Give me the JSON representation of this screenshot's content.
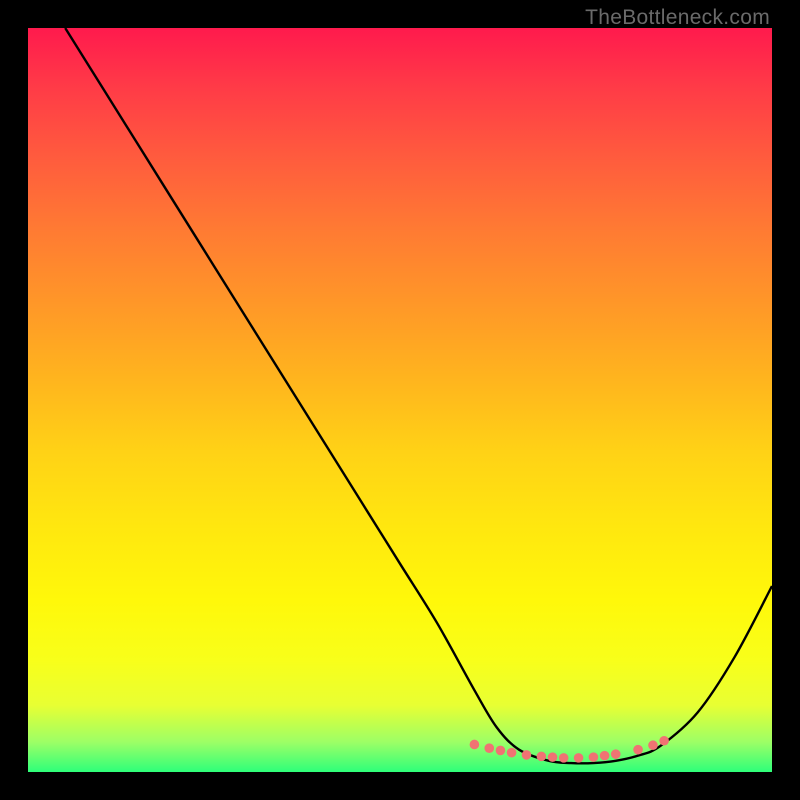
{
  "watermark": "TheBottleneck.com",
  "chart_data": {
    "type": "line",
    "title": "",
    "xlabel": "",
    "ylabel": "",
    "xlim": [
      0,
      100
    ],
    "ylim": [
      0,
      100
    ],
    "background_gradient": {
      "top_color": "#ff1a4d",
      "bottom_color": "#2eff7a",
      "meaning": "bottleneck intensity (red = high, green = low)"
    },
    "series": [
      {
        "name": "bottleneck-curve",
        "x": [
          5,
          10,
          15,
          20,
          25,
          30,
          35,
          40,
          45,
          50,
          55,
          60,
          63,
          66,
          70,
          73,
          76,
          79,
          82,
          85,
          90,
          95,
          100
        ],
        "y": [
          100,
          92,
          84,
          76,
          68,
          60,
          52,
          44,
          36,
          28,
          20,
          11,
          6,
          3,
          1.5,
          1.2,
          1.2,
          1.5,
          2.2,
          3.5,
          8,
          15.5,
          25
        ]
      }
    ],
    "highlight_points": {
      "comment": "soft-red dots near the trough",
      "x": [
        60,
        62,
        63.5,
        65,
        67,
        69,
        70.5,
        72,
        74,
        76,
        77.5,
        79,
        82,
        84,
        85.5
      ],
      "y": [
        3.7,
        3.2,
        2.9,
        2.6,
        2.3,
        2.1,
        2.0,
        1.9,
        1.9,
        2.0,
        2.2,
        2.4,
        3.0,
        3.6,
        4.2
      ]
    }
  }
}
